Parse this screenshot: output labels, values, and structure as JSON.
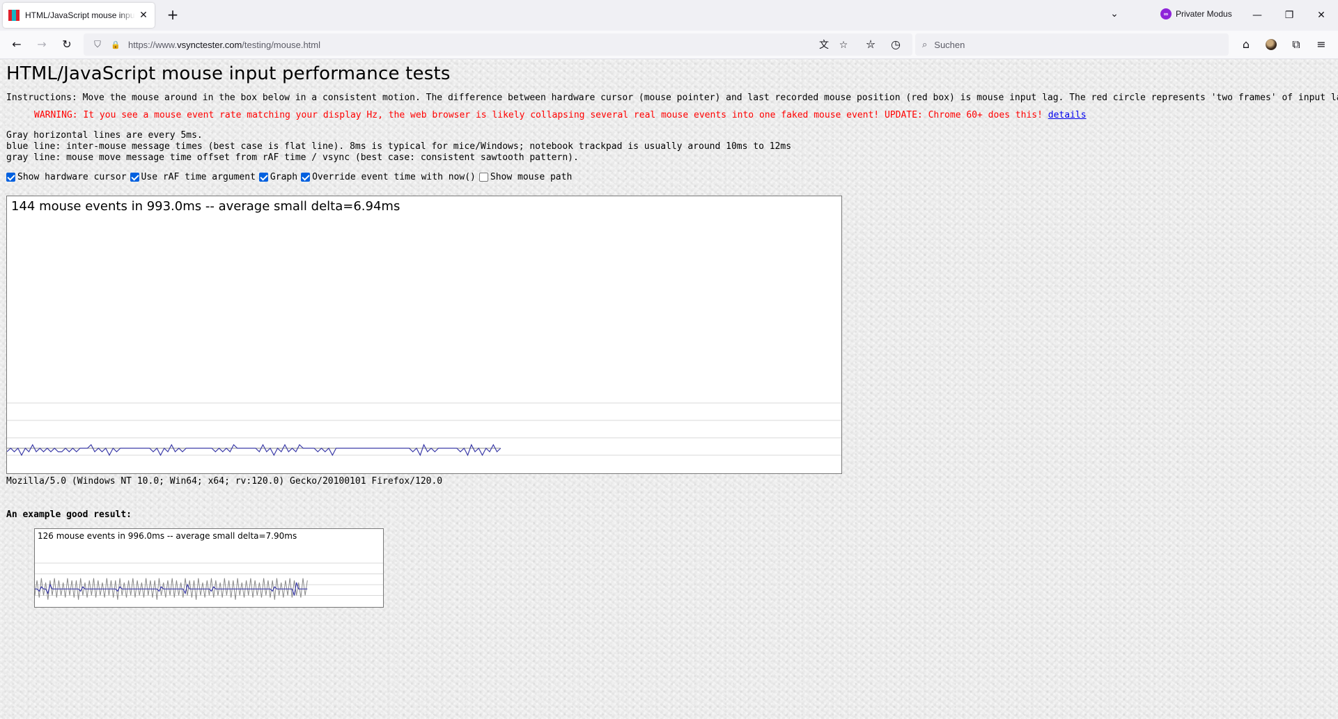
{
  "browser": {
    "tab": {
      "title": "HTML/JavaScript mouse input performance tests",
      "close_glyph": "✕"
    },
    "new_tab_glyph": "+",
    "tab_list_glyph": "⌄",
    "private_mode_label": "Privater Modus",
    "private_icon_glyph": "∞",
    "window_controls": {
      "minimize": "—",
      "restore": "❐",
      "close": "✕"
    },
    "url": {
      "prefix": "https://www.",
      "domain": "vsynctester.com",
      "path": "/testing/mouse.html"
    },
    "search_placeholder": "Suchen",
    "nav_icons": {
      "back": "←",
      "forward": "→",
      "reload": "↻",
      "shield": "⛉",
      "lock": "🔒",
      "translate": "文",
      "star": "☆",
      "bookmarks": "⛦",
      "history": "◷",
      "search": "⌕",
      "home": "⌂",
      "extensions": "⧉",
      "menu": "≡"
    }
  },
  "page": {
    "title": "HTML/JavaScript mouse input performance tests",
    "instructions": "Instructions: Move the mouse around in the box below in a consistent motion. The difference between hardware cursor (mouse pointer) and last recorded mouse position (red box) is mouse input lag. The red circle represents 'two frames' of input lag.",
    "warning_text": "WARNING: It you see a mouse event rate matching your display Hz, the web browser is likely collapsing several real mouse events into one faked mouse event! UPDATE: Chrome 60+ does this!",
    "warning_link": "details",
    "legend": [
      "Gray horizontal lines are every 5ms.",
      "blue line: inter-mouse message times (best case is flat line). 8ms is typical for mice/Windows; notebook trackpad is usually around 10ms to 12ms",
      "gray line: mouse move message time offset from rAF time / vsync (best case: consistent sawtooth pattern)."
    ],
    "options": [
      {
        "label": "Show hardware cursor",
        "checked": true
      },
      {
        "label": "Use rAF time argument",
        "checked": true
      },
      {
        "label": "Graph",
        "checked": true
      },
      {
        "label": "Override event time with now()",
        "checked": true
      },
      {
        "label": "Show mouse path",
        "checked": false
      }
    ],
    "test_stats": "144 mouse events in 993.0ms -- average small delta=6.94ms",
    "user_agent": "Mozilla/5.0 (Windows NT 10.0; Win64; x64; rv:120.0) Gecko/20100101 Firefox/120.0",
    "example_title": "An example good result:",
    "example_stats": "126 mouse events in 996.0ms -- average small delta=7.90ms"
  },
  "colors": {
    "blue_line": "#3a3aa8",
    "gray_line": "#8a8a8a",
    "grid_line": "#d8d8d8",
    "warning": "#ff0000",
    "checkbox": "#0060df"
  },
  "test_graph": {
    "blue_ms": [
      6,
      7,
      6,
      7,
      5,
      7,
      6,
      8,
      6,
      7,
      6,
      7,
      6,
      7,
      6,
      6,
      7,
      6,
      7,
      6,
      7,
      7,
      7,
      8,
      6,
      7,
      6,
      7,
      5,
      7,
      6,
      7,
      7,
      7,
      7,
      7,
      7,
      7,
      7,
      7,
      6,
      7,
      5,
      7,
      6,
      8,
      6,
      7,
      6,
      7,
      7,
      7,
      7,
      7,
      7,
      7,
      7,
      6,
      7,
      6,
      7,
      6,
      8,
      7,
      7,
      7,
      7,
      7,
      7,
      6,
      8,
      6,
      7,
      5,
      7,
      6,
      8,
      6,
      7,
      6,
      8,
      7,
      7,
      7,
      7,
      6,
      7,
      6,
      7,
      5,
      7,
      7,
      7,
      7,
      7,
      7,
      7,
      7,
      7,
      7,
      7,
      7,
      7,
      7,
      7,
      7,
      7,
      7,
      7,
      7,
      7,
      6,
      7,
      5,
      8,
      6,
      7,
      6,
      7,
      7,
      7,
      7,
      7,
      7,
      6,
      7,
      5,
      8,
      6,
      7,
      5,
      7,
      6,
      8,
      6,
      7
    ],
    "gray_ms": [
      7,
      7,
      7,
      7,
      7,
      7,
      7,
      7,
      7,
      7,
      7,
      7,
      7,
      7,
      7,
      7,
      7,
      7,
      7,
      7,
      7,
      7,
      7,
      7,
      7,
      7,
      7,
      7,
      7,
      7,
      7,
      7,
      7,
      7,
      7,
      7,
      7,
      7,
      7,
      7,
      7,
      7,
      7,
      7,
      7,
      7,
      7,
      7,
      7,
      7,
      7,
      7,
      7,
      7,
      7,
      7,
      7,
      7,
      7,
      7,
      7,
      7,
      7,
      7,
      7,
      7,
      7,
      7,
      7,
      7,
      7,
      7,
      7,
      7,
      7,
      7,
      7,
      7,
      7,
      7,
      7,
      7,
      7,
      7,
      7,
      7,
      7,
      7,
      7,
      7,
      7,
      7,
      7,
      7,
      7,
      7,
      7,
      7,
      7,
      7,
      7,
      7,
      7,
      7,
      7,
      7,
      7,
      7,
      7,
      7,
      7,
      7,
      7,
      7,
      7,
      7,
      7,
      7,
      7,
      7,
      7,
      7,
      7,
      7,
      7,
      7,
      7,
      7,
      7,
      7,
      7,
      7,
      7,
      7,
      7,
      7
    ]
  },
  "example_graph": {
    "blue_ms": [
      8,
      8,
      7,
      9,
      8,
      8,
      6,
      10,
      8,
      8,
      8,
      8,
      8,
      8,
      8,
      8,
      8,
      8,
      8,
      8,
      8,
      7,
      9,
      8,
      8,
      8,
      8,
      8,
      8,
      8,
      8,
      8,
      8,
      8,
      8,
      8,
      8,
      8,
      7,
      9,
      8,
      8,
      8,
      8,
      8,
      8,
      8,
      8,
      8,
      8,
      8,
      8,
      8,
      8,
      8,
      8,
      8,
      7,
      9,
      8,
      8,
      8,
      8,
      8,
      8,
      8,
      8,
      8,
      8,
      6,
      10,
      8,
      8,
      8,
      8,
      8,
      8,
      8,
      8,
      8,
      8,
      7,
      9,
      8,
      8,
      8,
      8,
      8,
      8,
      8,
      8,
      8,
      8,
      8,
      8,
      8,
      8,
      8,
      8,
      8,
      8,
      8,
      8,
      8,
      8,
      8,
      8,
      8,
      8,
      7,
      9,
      8,
      8,
      8,
      8,
      8,
      8,
      8,
      8,
      5,
      11,
      8,
      8,
      8,
      8,
      8
    ],
    "gray_ms": [
      5,
      12,
      4,
      13,
      5,
      11,
      3,
      12,
      5,
      13,
      4,
      12,
      5,
      11,
      4,
      13,
      5,
      12,
      4,
      12,
      3,
      13,
      5,
      11,
      4,
      12,
      5,
      13,
      4,
      12,
      5,
      11,
      4,
      13,
      5,
      12,
      4,
      12,
      3,
      13,
      5,
      11,
      4,
      12,
      5,
      13,
      4,
      12,
      5,
      11,
      4,
      13,
      5,
      12,
      4,
      12,
      3,
      13,
      5,
      11,
      4,
      12,
      5,
      13,
      4,
      12,
      5,
      11,
      4,
      13,
      5,
      12,
      4,
      12,
      3,
      13,
      5,
      11,
      4,
      12,
      5,
      13,
      4,
      12,
      5,
      11,
      4,
      13,
      5,
      12,
      4,
      12,
      3,
      13,
      5,
      11,
      4,
      12,
      5,
      13,
      4,
      12,
      5,
      11,
      4,
      13,
      5,
      12,
      4,
      12,
      3,
      13,
      5,
      11,
      4,
      12,
      5,
      13,
      4,
      12,
      5,
      11,
      4,
      13,
      5,
      12
    ]
  }
}
